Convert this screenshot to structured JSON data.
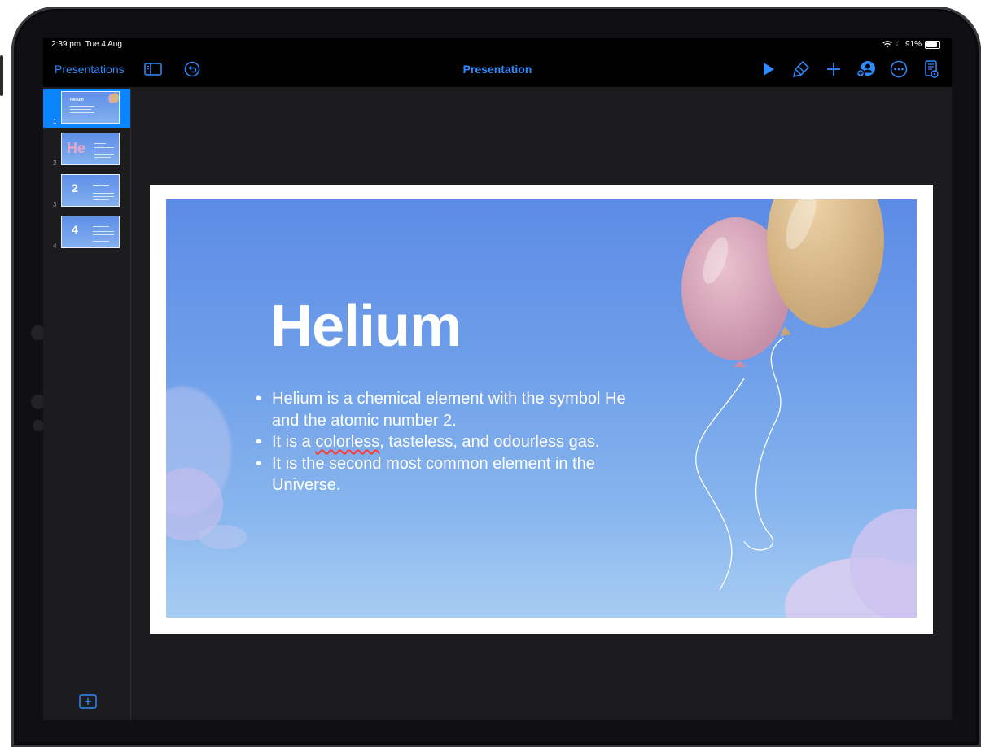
{
  "status_bar": {
    "time": "2:39 pm",
    "date": "Tue 4 Aug",
    "battery": "91%",
    "battery_level": 0.91
  },
  "toolbar": {
    "back_label": "Presentations",
    "title": "Presentation",
    "icons": [
      "sidebar-icon",
      "undo-icon",
      "play-icon",
      "format-brush-icon",
      "add-icon",
      "collaborate-icon",
      "more-icon",
      "document-icon"
    ]
  },
  "slides": [
    {
      "number": "1",
      "thumb_title": "Helium",
      "selected": true
    },
    {
      "number": "2",
      "thumb_title": "He",
      "selected": false
    },
    {
      "number": "3",
      "thumb_title": "2",
      "selected": false
    },
    {
      "number": "4",
      "thumb_title": "4",
      "selected": false
    }
  ],
  "current_slide": {
    "title": "Helium",
    "bullets": [
      "Helium is a chemical element with the symbol He and the atomic number 2.",
      "It is a colorless, tasteless, and odourless gas.",
      "It is the second most common element in the Universe."
    ],
    "bullet2_parts": {
      "before": "It is a ",
      "misspelled": "colorless",
      "after": ", tasteless, and odourless gas."
    }
  },
  "colors": {
    "accent": "#2f8cff",
    "selected": "#0a84ff",
    "background": "#1c1c1e"
  }
}
